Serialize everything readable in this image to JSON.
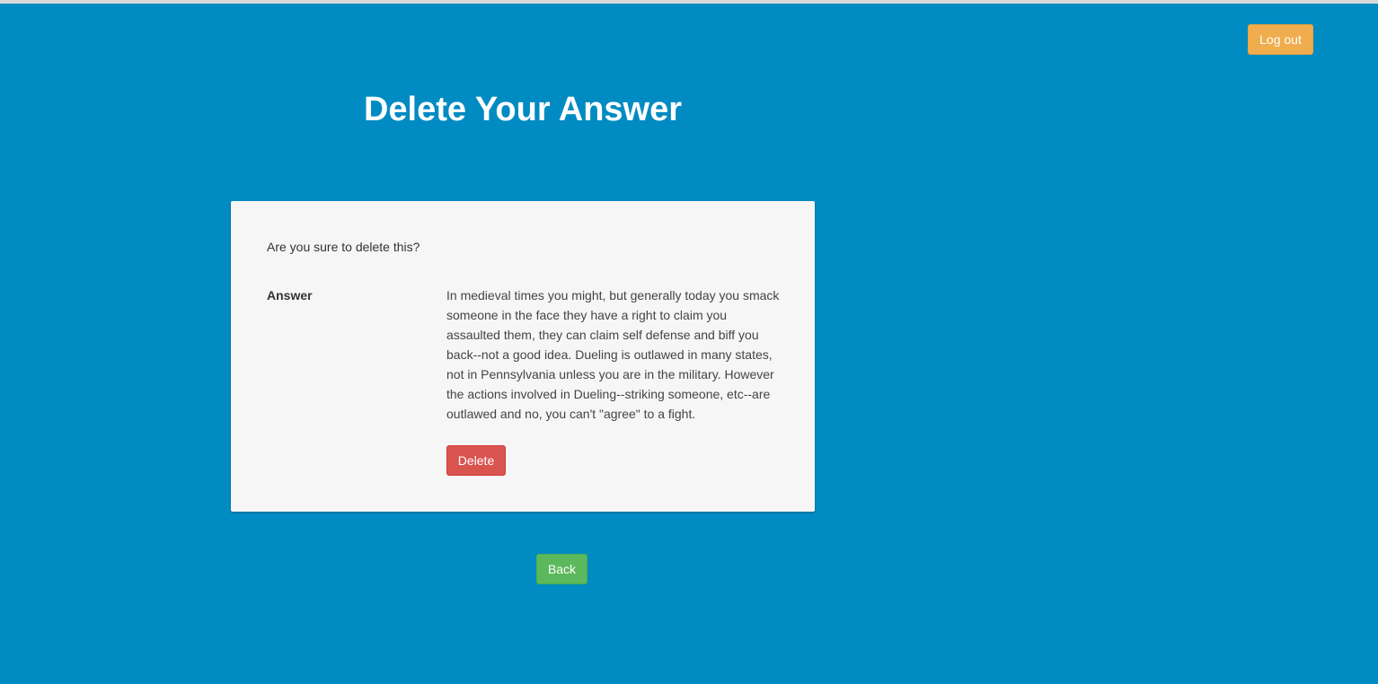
{
  "header": {
    "logout_label": "Log out"
  },
  "page": {
    "title": "Delete Your Answer"
  },
  "panel": {
    "confirm_text": "Are you sure to delete this?",
    "answer_label": "Answer",
    "answer_text": "In medieval times you might, but generally today you smack someone in the face they have a right to claim you assaulted them, they can claim self defense and biff you back--not a good idea. Dueling is outlawed in many states, not in Pennsylvania unless you are in the military. However the actions involved in Dueling--striking someone, etc--are outlawed and no, you can't \"agree\" to a fight.",
    "delete_label": "Delete"
  },
  "footer": {
    "back_label": "Back"
  },
  "colors": {
    "background": "#008bc2",
    "logout_button": "#f0ad4e",
    "delete_button": "#d9534f",
    "back_button": "#5cb85c",
    "panel": "#f6f6f6"
  }
}
